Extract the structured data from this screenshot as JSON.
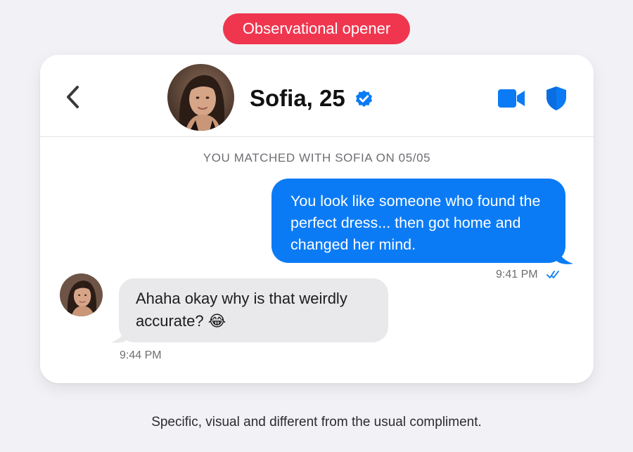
{
  "tag": {
    "label": "Observational opener",
    "color": "#f0364f"
  },
  "header": {
    "title": "Sofia, 25",
    "icons": [
      "back-chevron-icon",
      "verified-badge-icon",
      "video-call-icon",
      "shield-icon"
    ],
    "accent_color": "#0b7bf5"
  },
  "chat": {
    "match_note": "YOU MATCHED WITH SOFIA ON 05/05",
    "messages": [
      {
        "direction": "outgoing",
        "text": "You look like someone who found the perfect dress... then got home and changed her mind.",
        "time": "9:41 PM",
        "status_icon": "double-check-read-icon"
      },
      {
        "direction": "incoming",
        "text": "Ahaha okay why is that weirdly accurate? 😂",
        "time": "9:44 PM"
      }
    ]
  },
  "caption": "Specific, visual and different from the usual compliment."
}
